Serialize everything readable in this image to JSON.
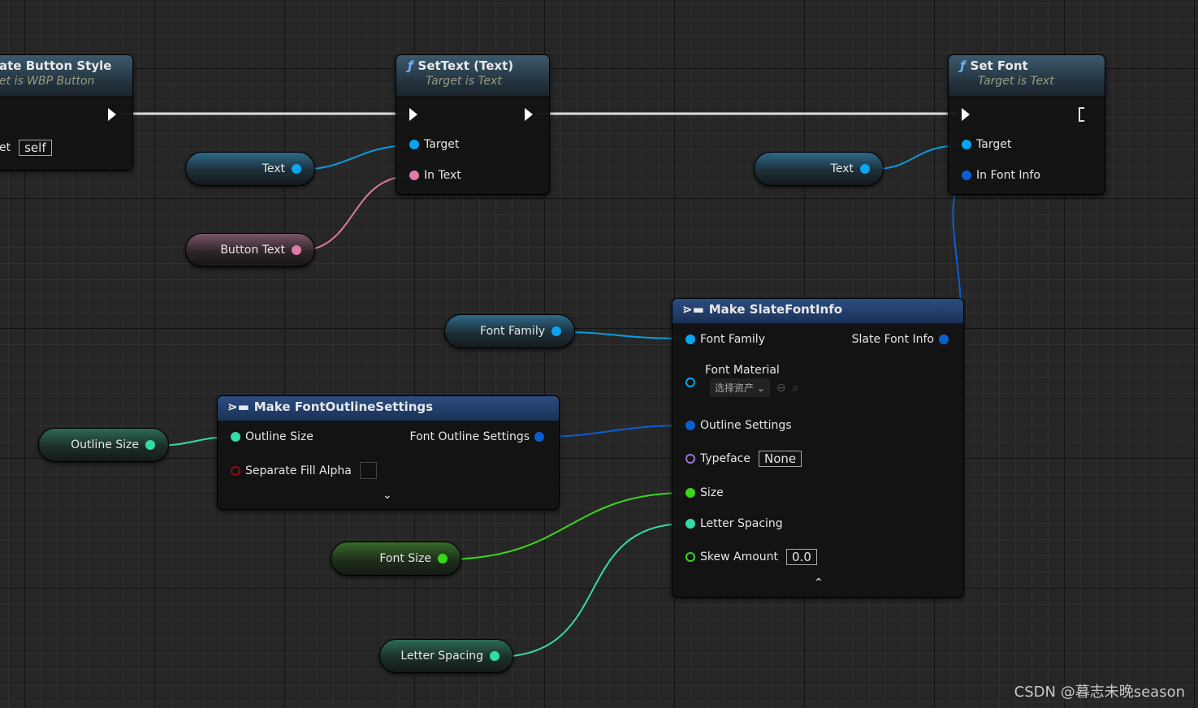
{
  "colors": {
    "object": "#0aa4f0",
    "text": "#e07aa8",
    "struct": "#0a5fd0",
    "float": "#33dba8",
    "int": "#3ad61c",
    "bool": "#8a0f0f",
    "material": "#0aa4f0",
    "typeface": "#a070d8"
  },
  "nodes": {
    "update_button_style": {
      "title": "ate Button Style",
      "subtitle": "et is WBP Button",
      "target_label": "et",
      "target_value": "self"
    },
    "set_text": {
      "icon": "function-icon",
      "title": "SetText (Text)",
      "subtitle": "Target is Text",
      "pins": [
        "Target",
        "In Text"
      ]
    },
    "set_font": {
      "icon": "function-icon",
      "title": "Set Font",
      "subtitle": "Target is Text",
      "pins": [
        "Target",
        "In Font Info"
      ]
    },
    "make_slate_font_info": {
      "title": "Make SlateFontInfo",
      "output": "Slate Font Info",
      "pins": {
        "font_family": "Font Family",
        "font_material": "Font Material",
        "asset_picker": "选择资产",
        "outline_settings": "Outline Settings",
        "typeface": "Typeface",
        "typeface_value": "None",
        "size": "Size",
        "letter_spacing": "Letter Spacing",
        "skew_amount": "Skew Amount",
        "skew_value": "0.0"
      }
    },
    "make_font_outline_settings": {
      "title": "Make FontOutlineSettings",
      "output": "Font Outline Settings",
      "pins": {
        "outline_size": "Outline Size",
        "separate_fill_alpha": "Separate Fill Alpha"
      },
      "separate_fill_alpha_checked": false
    }
  },
  "variables": {
    "text1": "Text",
    "button_text": "Button Text",
    "text2": "Text",
    "font_family": "Font Family",
    "outline_size": "Outline Size",
    "font_size": "Font Size",
    "letter_spacing": "Letter Spacing"
  },
  "watermark": "CSDN @暮志未晚season"
}
